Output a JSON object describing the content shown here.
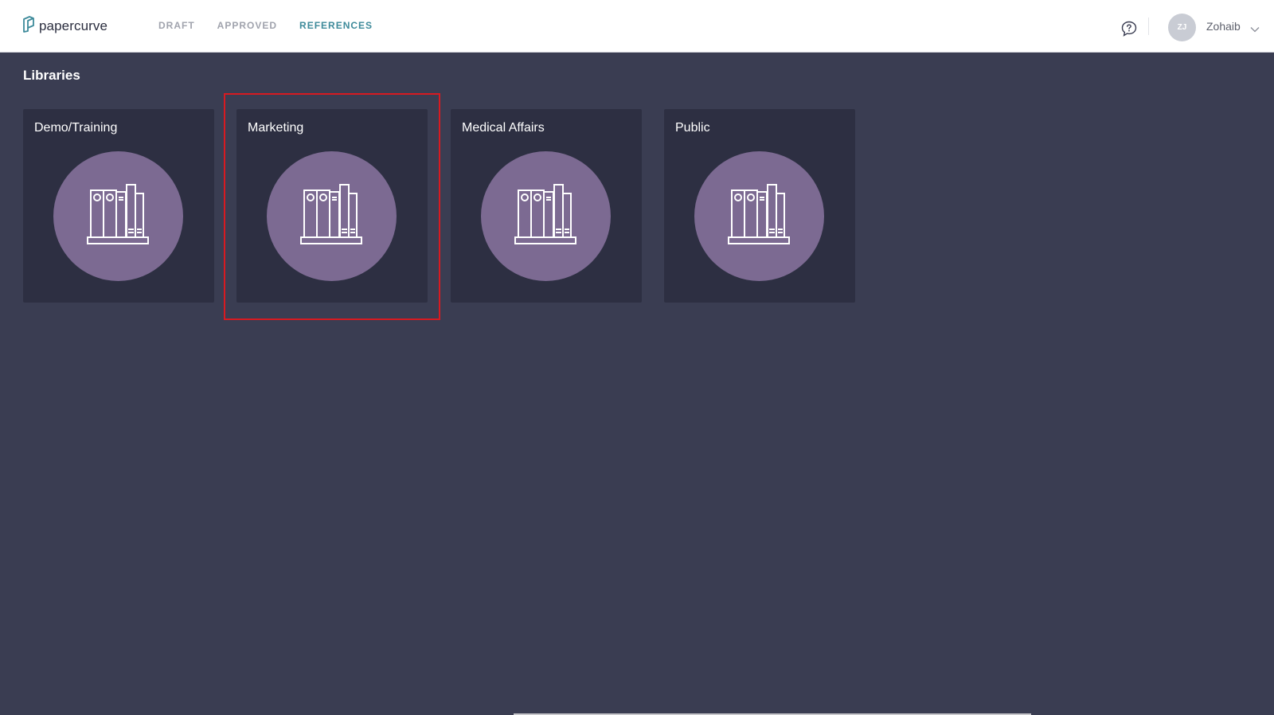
{
  "app": {
    "logo_text": "papercurve",
    "logo_icon": "papercurve-logo-icon"
  },
  "nav": {
    "items": [
      {
        "label": "DRAFT",
        "active": false
      },
      {
        "label": "APPROVED",
        "active": false
      },
      {
        "label": "REFERENCES",
        "active": true
      }
    ]
  },
  "user": {
    "initials": "ZJ",
    "name": "Zohaib",
    "chat_icon": "chat-help-icon",
    "menu_icon": "chevron-down-icon"
  },
  "page": {
    "title": "Libraries"
  },
  "libraries": [
    {
      "name": "Demo/Training",
      "icon": "library-binders-icon"
    },
    {
      "name": "Marketing",
      "icon": "library-binders-icon",
      "highlighted": true
    },
    {
      "name": "Medical Affairs",
      "icon": "library-binders-icon"
    },
    {
      "name": "Public",
      "icon": "library-binders-icon"
    }
  ],
  "colors": {
    "background": "#3a3d52",
    "card": "#2d2f42",
    "circle": "#7c6a92",
    "nav_active": "#3d8a9a",
    "highlight": "#d71a21"
  }
}
